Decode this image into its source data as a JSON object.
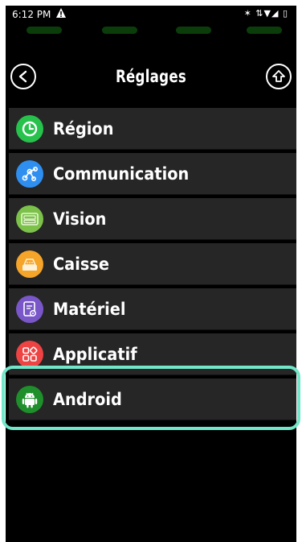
{
  "status_bar": {
    "time": "6:12 PM",
    "right_icons": "✶ ⇅▼◢ ▯"
  },
  "header": {
    "title": "Réglages"
  },
  "menu": {
    "items": [
      {
        "label": "Région",
        "icon": "clock-icon",
        "color": "#27c24c"
      },
      {
        "label": "Communication",
        "icon": "share-network-icon",
        "color": "#2f8ff0"
      },
      {
        "label": "Vision",
        "icon": "display-icon",
        "color": "#7cc24a"
      },
      {
        "label": "Caisse",
        "icon": "cash-register-icon",
        "color": "#f4a52a"
      },
      {
        "label": "Matériel",
        "icon": "device-settings-icon",
        "color": "#7a57c9"
      },
      {
        "label": "Applicatif",
        "icon": "apps-icon",
        "color": "#ee4343"
      },
      {
        "label": "Android",
        "icon": "android-icon",
        "color": "#1f8f2c"
      }
    ]
  },
  "colors": {
    "highlight": "#72e6c8",
    "item_background": "#262626"
  }
}
